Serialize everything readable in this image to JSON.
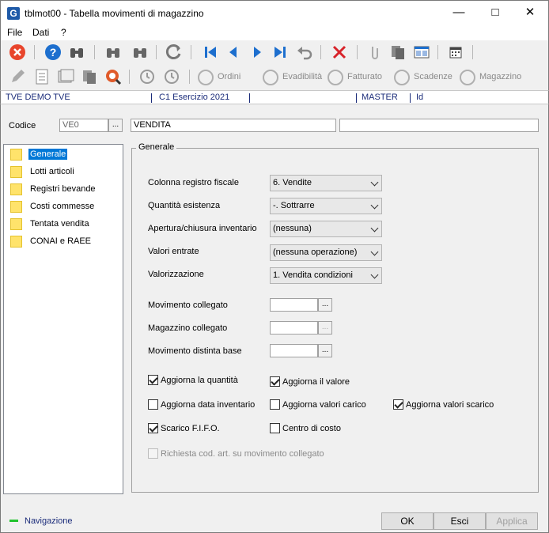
{
  "window": {
    "title": "tblmot00 - Tabella movimenti di magazzino",
    "app_icon_letter": "G"
  },
  "menu": [
    "File",
    "Dati",
    "?"
  ],
  "toolbar2_labels": {
    "ordini": "Ordini",
    "evadibilita": "Evadibilità",
    "fatturato": "Fatturato",
    "scadenze": "Scadenze",
    "magazzino": "Magazzino"
  },
  "status_strip": {
    "company": "TVE DEMO TVE",
    "period": "C1 Esercizio 2021",
    "user": "MASTER",
    "id_label": "Id"
  },
  "header": {
    "codice_label": "Codice",
    "codice_value": "VE0",
    "descrizione_value": "VENDITA",
    "extra_value": ""
  },
  "tree": [
    {
      "label": "Generale",
      "selected": true
    },
    {
      "label": "Lotti articoli"
    },
    {
      "label": "Registri bevande"
    },
    {
      "label": "Costi commesse"
    },
    {
      "label": "Tentata vendita"
    },
    {
      "label": "CONAI e RAEE"
    }
  ],
  "group": {
    "title": "Generale",
    "fields": {
      "colonna_registro_label": "Colonna registro fiscale",
      "colonna_registro_value": "6. Vendite",
      "quantita_esistenza_label": "Quantità esistenza",
      "quantita_esistenza_value": "-. Sottrarre",
      "apertura_label": "Apertura/chiusura inventario",
      "apertura_value": "(nessuna)",
      "valori_entrate_label": "Valori entrate",
      "valori_entrate_value": "(nessuna operazione)",
      "valorizzazione_label": "Valorizzazione",
      "valorizzazione_value": "1. Vendita condizioni",
      "mov_collegato_label": "Movimento collegato",
      "mag_collegato_label": "Magazzino collegato",
      "mov_distinta_label": "Movimento distinta base",
      "browse_label": "..."
    },
    "checkboxes": {
      "aggiorna_quantita": {
        "label": "Aggiorna la quantità",
        "checked": true
      },
      "aggiorna_valore": {
        "label": "Aggiorna il valore",
        "checked": true
      },
      "aggiorna_data_inv": {
        "label": "Aggiorna data inventario",
        "checked": false
      },
      "aggiorna_valori_carico": {
        "label": "Aggiorna valori carico",
        "checked": false
      },
      "aggiorna_valori_scarico": {
        "label": "Aggiorna valori scarico",
        "checked": true
      },
      "scarico_fifo": {
        "label": "Scarico F.I.F.O.",
        "checked": true
      },
      "centro_costo": {
        "label": "Centro di costo",
        "checked": false
      },
      "richiesta_cod_art": {
        "label": "Richiesta cod. art. su movimento collegato",
        "checked": false,
        "disabled": true
      }
    }
  },
  "footer": {
    "nav_label": "Navigazione",
    "ok": "OK",
    "esci": "Esci",
    "applica": "Applica"
  },
  "colors": {
    "accent_blue": "#0078d7",
    "strip_text": "#1b2c7a",
    "folder_yellow": "#ffe36b",
    "nav_green": "#22c22e"
  }
}
